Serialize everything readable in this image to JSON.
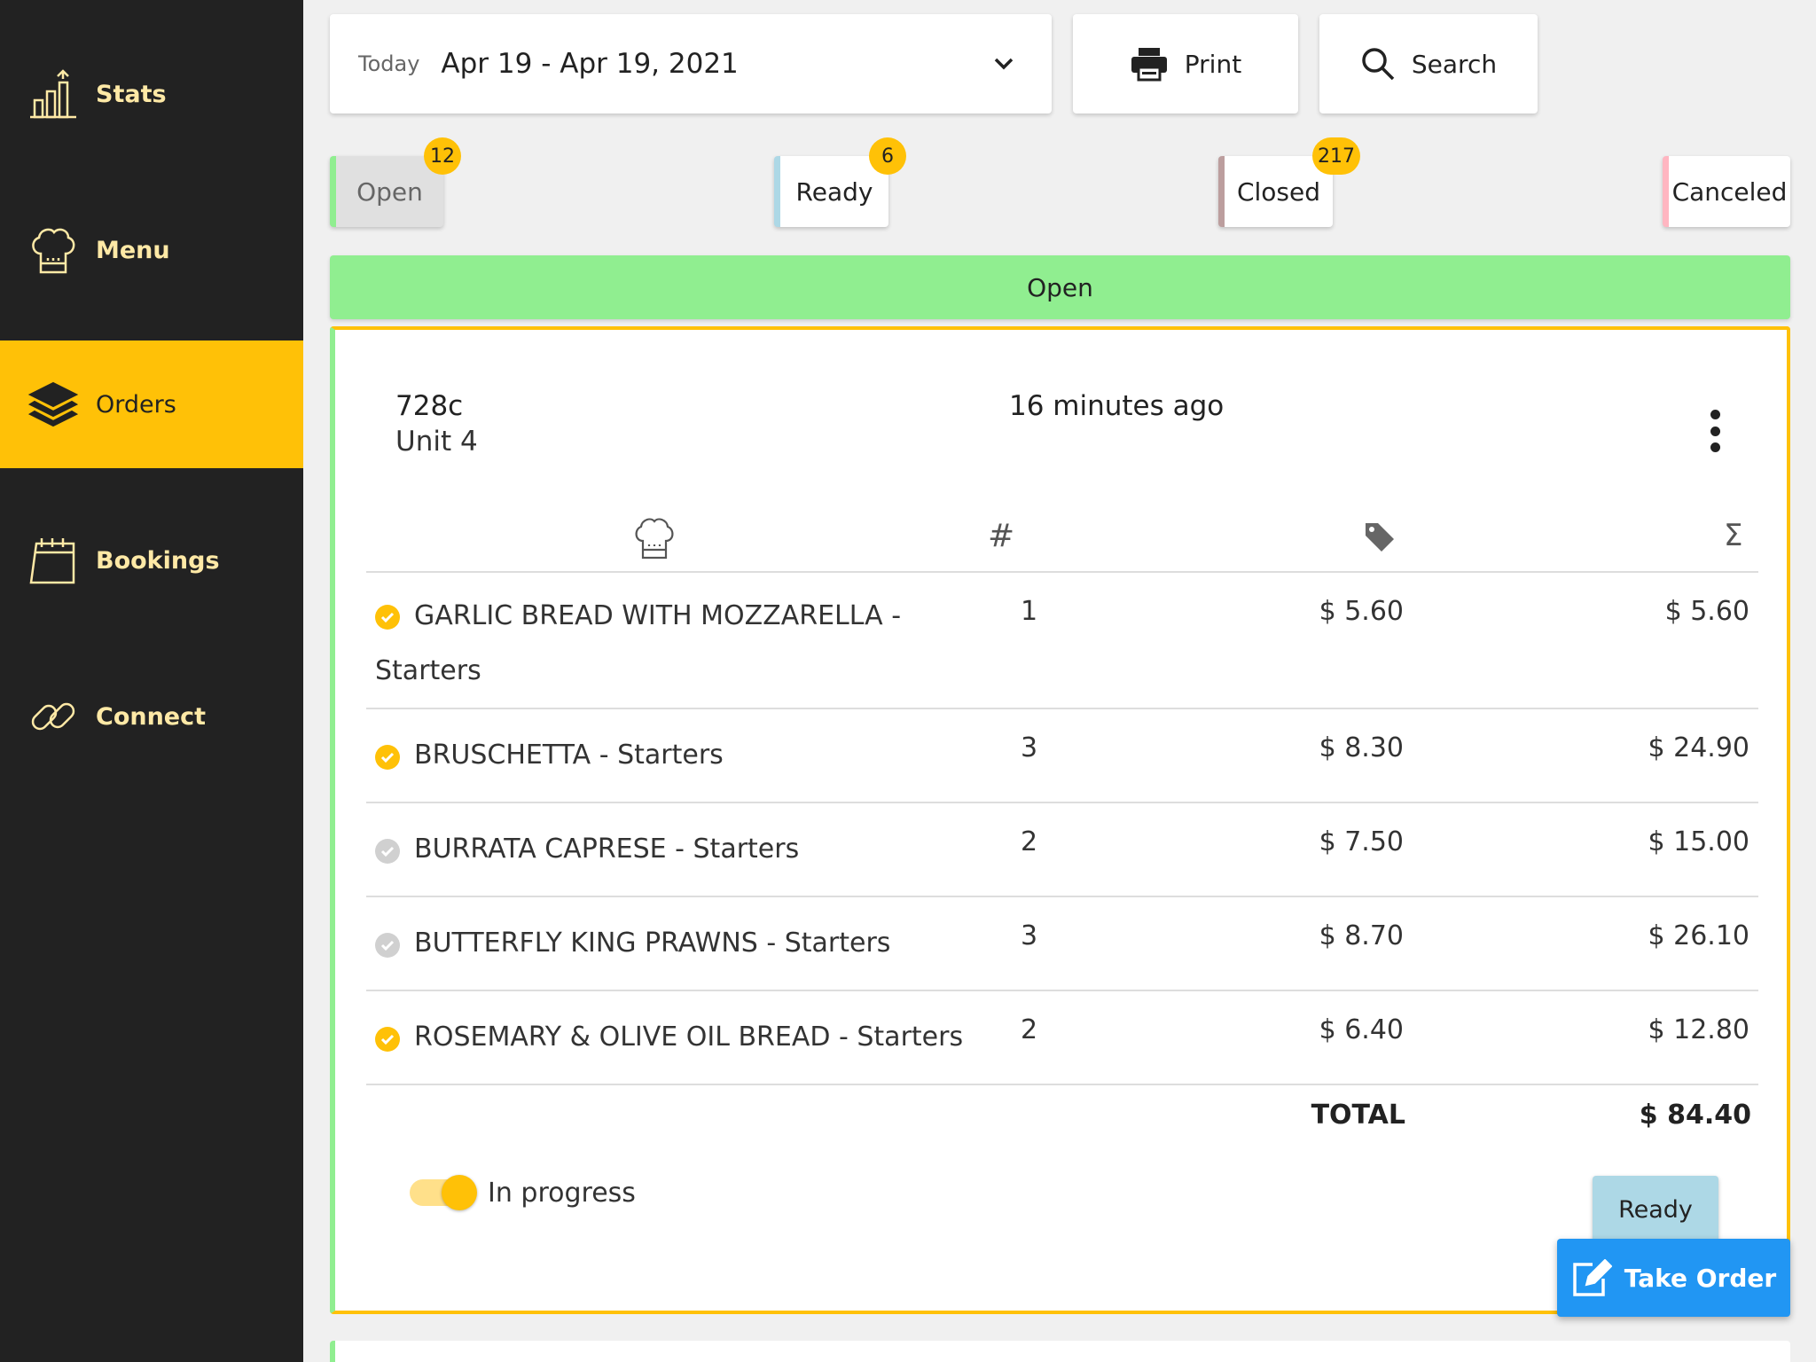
{
  "sidebar": {
    "items": [
      {
        "label": "Stats",
        "icon": "chart-icon"
      },
      {
        "label": "Menu",
        "icon": "chef-hat-icon"
      },
      {
        "label": "Orders",
        "icon": "layers-icon",
        "active": true
      },
      {
        "label": "Bookings",
        "icon": "calendar-icon"
      },
      {
        "label": "Connect",
        "icon": "link-icon"
      }
    ]
  },
  "topbar": {
    "date_prefix": "Today",
    "date_range": "Apr 19 - Apr 19, 2021",
    "print_label": "Print",
    "search_label": "Search"
  },
  "status_tabs": [
    {
      "label": "Open",
      "count": "12"
    },
    {
      "label": "Ready",
      "count": "6"
    },
    {
      "label": "Closed",
      "count": "217"
    },
    {
      "label": "Canceled",
      "count": ""
    }
  ],
  "section_title": "Open",
  "order": {
    "id": "728c",
    "unit": "Unit 4",
    "time_ago": "16 minutes ago",
    "columns": {
      "qty": "#",
      "sum": "Σ"
    },
    "items": [
      {
        "name": "GARLIC BREAD WITH MOZZARELLA - Starters",
        "qty": "1",
        "price": "$ 5.60",
        "sum": "$ 5.60",
        "done": true
      },
      {
        "name": "BRUSCHETTA - Starters",
        "qty": "3",
        "price": "$ 8.30",
        "sum": "$ 24.90",
        "done": true
      },
      {
        "name": "BURRATA CAPRESE - Starters",
        "qty": "2",
        "price": "$ 7.50",
        "sum": "$ 15.00",
        "done": false
      },
      {
        "name": "BUTTERFLY KING PRAWNS - Starters",
        "qty": "3",
        "price": "$ 8.70",
        "sum": "$ 26.10",
        "done": false
      },
      {
        "name": "ROSEMARY & OLIVE OIL BREAD - Starters",
        "qty": "2",
        "price": "$ 6.40",
        "sum": "$ 12.80",
        "done": true
      }
    ],
    "total_label": "TOTAL",
    "total_value": "$ 84.40",
    "toggle_label": "In progress",
    "ready_label": "Ready"
  },
  "take_order_label": "Take Order",
  "colors": {
    "sidebar_bg": "#222222",
    "accent": "#ffc107",
    "open": "#90ee90",
    "ready": "#add8e6",
    "closed": "#bc9e9e",
    "canceled": "#ffb6c1",
    "primary": "#2196f3"
  }
}
